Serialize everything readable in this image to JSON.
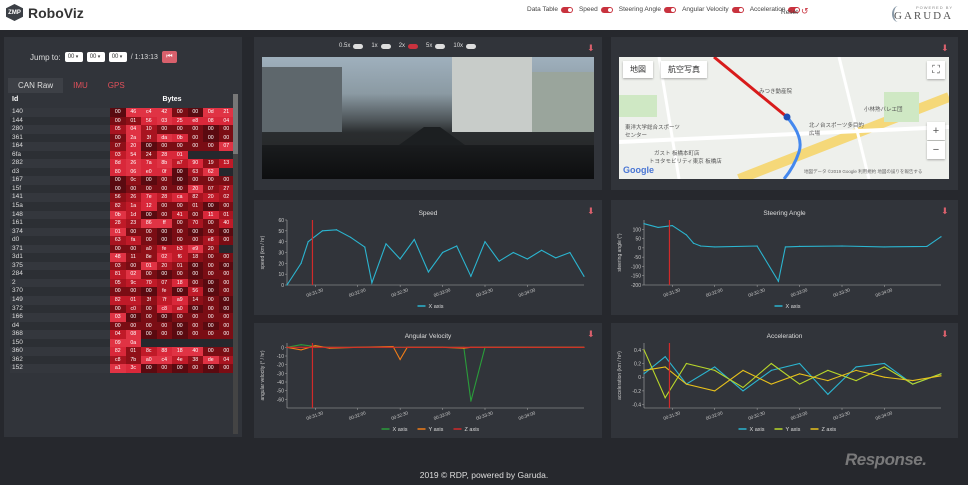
{
  "app": {
    "title": "RoboViz",
    "logo_text": "ZMP"
  },
  "toggles": [
    {
      "label": "Data Table"
    },
    {
      "label": "Speed"
    },
    {
      "label": "Steering Angle"
    },
    {
      "label": "Angular Velocity"
    },
    {
      "label": "Acceleration"
    }
  ],
  "reset_label": "Reset",
  "garuda": {
    "powered": "POWERED BY",
    "name": "GARUDA"
  },
  "jump": {
    "label": "Jump to:",
    "h": "00",
    "m": "00",
    "s": "00",
    "end": "/ 1:13:13"
  },
  "tabs": [
    "CAN Raw",
    "IMU",
    "GPS"
  ],
  "table": {
    "headers": [
      "Id",
      "Bytes"
    ],
    "rows": [
      {
        "id": "140",
        "b": [
          "00",
          "46",
          "c4",
          "42",
          "00",
          "00",
          "0d",
          "21"
        ]
      },
      {
        "id": "144",
        "b": [
          "00",
          "01",
          "56",
          "03",
          "25",
          "e8",
          "08",
          "04"
        ]
      },
      {
        "id": "280",
        "b": [
          "05",
          "04",
          "10",
          "00",
          "00",
          "00",
          "00",
          "00"
        ]
      },
      {
        "id": "361",
        "b": [
          "00",
          "2a",
          "3f",
          "da",
          "0b",
          "00",
          "00",
          "00"
        ]
      },
      {
        "id": "164",
        "b": [
          "07",
          "20",
          "00",
          "00",
          "00",
          "00",
          "00",
          "07"
        ]
      },
      {
        "id": "6fa",
        "b": [
          "03",
          "54",
          "24",
          "28",
          "01",
          "",
          "",
          ""
        ]
      },
      {
        "id": "282",
        "b": [
          "8d",
          "26",
          "7a",
          "8b",
          "a7",
          "90",
          "19",
          "13"
        ]
      },
      {
        "id": "d3",
        "b": [
          "80",
          "06",
          "e0",
          "0f",
          "00",
          "63",
          "62",
          ""
        ]
      },
      {
        "id": "167",
        "b": [
          "00",
          "0c",
          "00",
          "00",
          "00",
          "00",
          "00",
          "00"
        ]
      },
      {
        "id": "15f",
        "b": [
          "00",
          "00",
          "00",
          "00",
          "00",
          "20",
          "07",
          "27"
        ]
      },
      {
        "id": "141",
        "b": [
          "56",
          "26",
          "7e",
          "28",
          "ca",
          "82",
          "20",
          "02"
        ]
      },
      {
        "id": "15a",
        "b": [
          "82",
          "1a",
          "12",
          "00",
          "00",
          "01",
          "00",
          "00"
        ]
      },
      {
        "id": "148",
        "b": [
          "0b",
          "1d",
          "00",
          "00",
          "41",
          "00",
          "11",
          "01"
        ]
      },
      {
        "id": "161",
        "b": [
          "28",
          "23",
          "86",
          "ff",
          "00",
          "70",
          "00",
          "40"
        ]
      },
      {
        "id": "374",
        "b": [
          "01",
          "00",
          "00",
          "00",
          "00",
          "00",
          "00",
          "00"
        ]
      },
      {
        "id": "d0",
        "b": [
          "63",
          "fa",
          "00",
          "00",
          "00",
          "00",
          "e8",
          "00"
        ]
      },
      {
        "id": "371",
        "b": [
          "00",
          "00",
          "a0",
          "fe",
          "b3",
          "e9",
          "20",
          ""
        ]
      },
      {
        "id": "3d1",
        "b": [
          "48",
          "11",
          "8e",
          "02",
          "f6",
          "18",
          "00",
          "00"
        ]
      },
      {
        "id": "375",
        "b": [
          "03",
          "00",
          "01",
          "20",
          "01",
          "00",
          "00",
          "00"
        ]
      },
      {
        "id": "284",
        "b": [
          "81",
          "02",
          "00",
          "00",
          "00",
          "00",
          "00",
          "00"
        ]
      },
      {
        "id": "2",
        "b": [
          "05",
          "9c",
          "70",
          "07",
          "18",
          "00",
          "00",
          "00"
        ]
      },
      {
        "id": "370",
        "b": [
          "00",
          "00",
          "00",
          "fe",
          "00",
          "56",
          "00",
          "00"
        ]
      },
      {
        "id": "149",
        "b": [
          "82",
          "01",
          "3f",
          "7f",
          "a9",
          "14",
          "00",
          "00"
        ]
      },
      {
        "id": "372",
        "b": [
          "00",
          "c0",
          "00",
          "c8",
          "a0",
          "00",
          "00",
          "00"
        ]
      },
      {
        "id": "166",
        "b": [
          "03",
          "00",
          "00",
          "00",
          "00",
          "00",
          "00",
          "00"
        ]
      },
      {
        "id": "d4",
        "b": [
          "00",
          "00",
          "00",
          "00",
          "00",
          "00",
          "00",
          "00"
        ]
      },
      {
        "id": "368",
        "b": [
          "04",
          "08",
          "00",
          "00",
          "00",
          "00",
          "00",
          "00"
        ]
      },
      {
        "id": "150",
        "b": [
          "09",
          "0a",
          "",
          "",
          "",
          "",
          "",
          ""
        ]
      },
      {
        "id": "360",
        "b": [
          "82",
          "01",
          "8c",
          "88",
          "18",
          "40",
          "00",
          "00"
        ]
      },
      {
        "id": "362",
        "b": [
          "c8",
          "7b",
          "a0",
          "c4",
          "4e",
          "38",
          "de",
          "04"
        ]
      },
      {
        "id": "152",
        "b": [
          "a1",
          "3c",
          "00",
          "00",
          "00",
          "00",
          "00",
          "00"
        ]
      }
    ]
  },
  "video": {
    "speeds": [
      "0.5x",
      "1x",
      "2x",
      "5x",
      "10x"
    ]
  },
  "map": {
    "btn_map": "地図",
    "btn_sat": "航空写真",
    "labels": [
      "みつき動産院",
      "東洋大学総合スポーツセンター",
      "北ノ台スポーツ多目的広場",
      "トヨタモビリティ東京 板橋店",
      "小林熟バレエ団",
      "ガスト 板橋本町店"
    ],
    "google": "Google",
    "copyright": "地図データ ©2019 Google  利用規約  地図の誤りを報告する"
  },
  "charts": [
    {
      "key": "speed",
      "title": "Speed",
      "ylabel": "speed (km / hr)",
      "ylim": [
        0,
        60
      ],
      "yticks": [
        0,
        10,
        20,
        30,
        40,
        50,
        60
      ],
      "xticks": [
        "00:31:30",
        "00:32:00",
        "00:32:30",
        "00:33:00",
        "00:33:30",
        "00:34:00"
      ],
      "legend": [
        {
          "name": "X axis",
          "color": "#2bb5d0"
        }
      ]
    },
    {
      "key": "steer",
      "title": "Steering Angle",
      "ylabel": "steering angle (°)",
      "ylim": [
        -200,
        150
      ],
      "yticks": [
        -200,
        -150,
        -100,
        -50,
        0,
        50,
        100
      ],
      "xticks": [
        "00:31:30",
        "00:32:00",
        "00:32:30",
        "00:33:00",
        "00:33:30",
        "00:34:00"
      ],
      "legend": [
        {
          "name": "X axis",
          "color": "#2bb5d0"
        }
      ]
    },
    {
      "key": "angvel",
      "title": "Angular Velocity",
      "ylabel": "angular velocity (° / hr)",
      "ylim": [
        -70,
        5
      ],
      "yticks": [
        -60,
        -50,
        -40,
        -30,
        -20,
        -10,
        0
      ],
      "xticks": [
        "00:31:30",
        "00:32:00",
        "00:32:30",
        "00:33:00",
        "00:33:30",
        "00:34:00"
      ],
      "legend": [
        {
          "name": "X axis",
          "color": "#2a9d3a"
        },
        {
          "name": "Y axis",
          "color": "#f07d18"
        },
        {
          "name": "Z axis",
          "color": "#d12a2a"
        }
      ]
    },
    {
      "key": "accel",
      "title": "Acceleration",
      "ylabel": "acceleration (km / hr²)",
      "ylim": [
        -0.45,
        0.5
      ],
      "yticks": [
        -0.4,
        -0.2,
        0,
        0.2,
        0.4
      ],
      "xticks": [
        "00:31:30",
        "00:32:00",
        "00:32:30",
        "00:33:00",
        "00:33:30",
        "00:34:00"
      ],
      "legend": [
        {
          "name": "X axis",
          "color": "#2bb5d0"
        },
        {
          "name": "Y axis",
          "color": "#b8d62a"
        },
        {
          "name": "Z axis",
          "color": "#e8c21c"
        }
      ]
    }
  ],
  "chart_data": [
    {
      "type": "line",
      "title": "Speed",
      "ylabel": "speed (km / hr)",
      "ylim": [
        0,
        60
      ],
      "x": [
        "00:31:10",
        "00:31:20",
        "00:31:25",
        "00:31:35",
        "00:31:45",
        "00:31:55",
        "00:32:05",
        "00:32:10",
        "00:32:20",
        "00:32:30",
        "00:32:40",
        "00:32:50",
        "00:33:00",
        "00:33:10",
        "00:33:20",
        "00:33:30",
        "00:33:40",
        "00:33:50",
        "00:34:00",
        "00:34:10",
        "00:34:20",
        "00:34:30",
        "00:34:40"
      ],
      "series": [
        {
          "name": "X axis",
          "values": [
            0,
            20,
            40,
            50,
            51,
            44,
            35,
            2,
            38,
            24,
            42,
            12,
            30,
            36,
            8,
            40,
            22,
            30,
            24,
            32,
            25,
            30,
            8
          ]
        }
      ]
    },
    {
      "type": "line",
      "title": "Steering Angle",
      "ylabel": "steering angle (°)",
      "ylim": [
        -200,
        150
      ],
      "x": [
        "00:31:10",
        "00:31:20",
        "00:31:30",
        "00:31:40",
        "00:31:45",
        "00:31:50",
        "00:32:00",
        "00:32:30",
        "00:32:45",
        "00:32:50",
        "00:33:00",
        "00:33:30",
        "00:34:00",
        "00:34:30",
        "00:34:40"
      ],
      "series": [
        {
          "name": "X axis",
          "values": [
            130,
            110,
            120,
            70,
            25,
            10,
            5,
            10,
            -180,
            5,
            8,
            10,
            5,
            8,
            60
          ]
        }
      ]
    },
    {
      "type": "line",
      "title": "Angular Velocity",
      "ylabel": "angular velocity (° / hr)",
      "ylim": [
        -70,
        5
      ],
      "x": [
        "00:31:10",
        "00:31:20",
        "00:31:30",
        "00:31:40",
        "00:32:00",
        "00:32:25",
        "00:32:30",
        "00:32:35",
        "00:33:00",
        "00:33:15",
        "00:33:20",
        "00:33:30",
        "00:34:00",
        "00:34:40"
      ],
      "series": [
        {
          "name": "X axis",
          "values": [
            0,
            3,
            1,
            0,
            0,
            0,
            0,
            0,
            0,
            0,
            -62,
            0,
            0,
            0
          ]
        },
        {
          "name": "Y axis",
          "values": [
            0,
            -3,
            2,
            -1,
            0,
            1,
            -14,
            0,
            0,
            -1,
            0,
            0,
            0,
            0
          ]
        },
        {
          "name": "Z axis",
          "values": [
            0,
            0,
            0,
            0,
            0,
            0,
            0,
            0,
            0,
            0,
            0,
            0,
            0,
            0
          ]
        }
      ]
    },
    {
      "type": "line",
      "title": "Acceleration",
      "ylabel": "acceleration (km / hr²)",
      "ylim": [
        -0.45,
        0.5
      ],
      "x": [
        "00:31:10",
        "00:31:25",
        "00:31:40",
        "00:32:00",
        "00:32:20",
        "00:32:40",
        "00:33:00",
        "00:33:20",
        "00:33:40",
        "00:34:00",
        "00:34:20",
        "00:34:40"
      ],
      "series": [
        {
          "name": "X axis",
          "values": [
            0.05,
            0.3,
            -0.1,
            0.15,
            -0.2,
            0.1,
            0.2,
            -0.25,
            0.15,
            0.2,
            -0.1,
            0.05
          ]
        },
        {
          "name": "Y axis",
          "values": [
            0.4,
            -0.3,
            0.2,
            0.1,
            -0.15,
            0.2,
            -0.1,
            0.1,
            -0.05,
            0.15,
            -0.1,
            0.05
          ]
        },
        {
          "name": "Z axis",
          "values": [
            0.1,
            0.15,
            -0.1,
            -0.2,
            0.1,
            -0.1,
            0.05,
            -0.05,
            0.1,
            0,
            -0.05,
            0.02
          ]
        }
      ]
    }
  ],
  "footer": "2019 © RDP, powered by Garuda.",
  "watermark": "Response."
}
